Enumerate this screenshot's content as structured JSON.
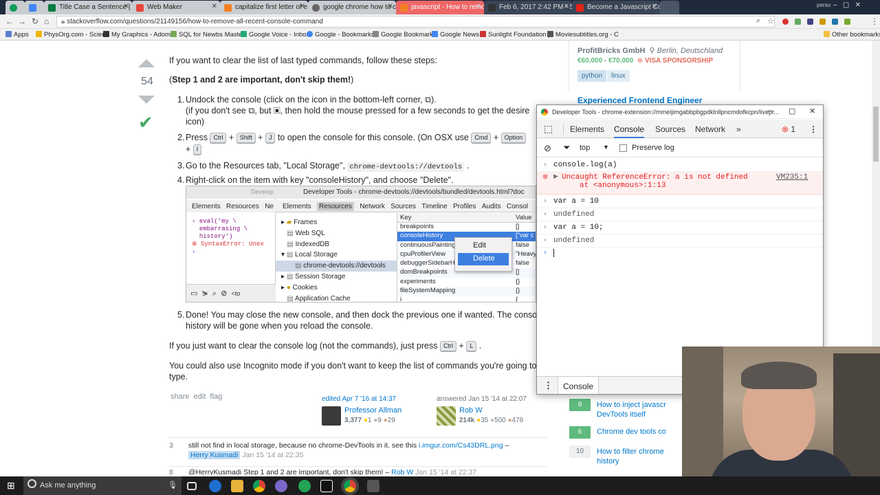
{
  "tabs": [
    {
      "label": "",
      "color": "#0f9d58"
    },
    {
      "label": "",
      "color": "#4285f4"
    },
    {
      "label": "Title Case a Sentence | Fr",
      "color": "#0a7b3e"
    },
    {
      "label": "Web Maker",
      "color": "#e8453c"
    },
    {
      "label": "capitalize first letter of e",
      "color": "#f48024"
    },
    {
      "label": "google chrome how to c",
      "color": "#666"
    },
    {
      "label": "javascript - How to remo",
      "color": "#f48024"
    },
    {
      "label": "Feb 6, 2017 2:42 PM - Sc",
      "color": "#333"
    },
    {
      "label": "Become a Javascript Con",
      "color": "#e62117"
    }
  ],
  "profile": "perso",
  "address": "stackoverflow.com/questions/21149156/how-to-remove-all-recent-console-command",
  "bookmarks": [
    "Apps",
    "PhysOrg.com - Scien",
    "My Graphics - Adom",
    "SQL for Newbs Maste",
    "Google Voice - Inbox",
    "Google - Bookmarks",
    "Google Bookmark",
    "Google News",
    "Sunlight Foundation |",
    "Moviesubtitles.org - С"
  ],
  "other_bookmarks": "Other bookmarks",
  "answer": {
    "vote_count": "54",
    "intro": "If you want to clear the list of last typed commands, follow these steps:",
    "bold_note": "Step 1 and 2 are important, don't skip them!",
    "step1_a": "Undock the console (click on the icon in the bottom-left corner,",
    "step1_b": "(if you don't see",
    "step1_c": ", but",
    "step1_d": ", then hold the mouse pressed for a few seconds to get the desire",
    "step1_e": "icon)",
    "step2_a": "Press",
    "step2_b": "to open the console for this console. (On OSX use",
    "key_ctrl": "Ctrl",
    "key_shift": "Shift",
    "key_j": "J",
    "key_cmd": "Cmd",
    "key_option": "Option",
    "key_i": "I",
    "key_l": "L",
    "step3": "Go to the Resources tab, \"Local Storage\",",
    "step3_code": "chrome-devtools://devtools",
    "step4": "Right-click on the item with key \"consoleHistory\", and choose \"Delete\".",
    "step5_a": "Done! You may close the new console, and then dock the previous one if wanted. The consol",
    "step5_b": "history will be gone when you reload the console.",
    "clear_log": "If you just want to clear the console log (not the commands), just press",
    "incognito_a": "You could also use Incognito mode if you don't want to keep the list of commands you're going to",
    "incognito_b": "type.",
    "actions": [
      "share",
      "edit",
      "flag"
    ],
    "edited": "edited Apr 7 '16 at 14:37",
    "editor": "Professor Allman",
    "editor_rep": "3,377",
    "editor_badges": [
      "1",
      "9",
      "29"
    ],
    "answered": "answered Jan 15 '14 at 22:07",
    "author": "Rob W",
    "author_rep": "214k",
    "author_badges": [
      "35",
      "500",
      "478"
    ]
  },
  "comments": [
    {
      "score": "3",
      "text": "still not find in local storage, because no chrome-DevTools in it. see this",
      "link": "i.imgur.com/Cs43DRL.png",
      "user": "Herry Kusmadi",
      "time": "Jan 15 '14 at 22:35"
    },
    {
      "score": "8",
      "text": "@HerryKusmadi Step 1 and 2 are important, don't skip them!",
      "link": "",
      "user": "Rob W",
      "time": "Jan 15 '14 at 22:37"
    }
  ],
  "embedded": {
    "left_tabs": [
      "Elements",
      "Resources",
      "Ne"
    ],
    "left_title": "Develop",
    "left_code": [
      "eval('my \\",
      "embarrasing \\",
      "history')",
      "SyntaxError: Unex"
    ],
    "title": "Developer Tools - chrome-devtools://devtools/bundled/devtools.html?doc",
    "tabs": [
      "Elements",
      "Resources",
      "Network",
      "Sources",
      "Timeline",
      "Profiles",
      "Audits",
      "Consol"
    ],
    "tree": [
      "Frames",
      "Web SQL",
      "IndexedDB",
      "Local Storage",
      "chrome-devtools://devtools",
      "Session Storage",
      "Cookies",
      "Application Cache"
    ],
    "col_key": "Key",
    "col_value": "Value",
    "keys": [
      "breakpoints",
      "consoleHistory",
      "continuousPainting",
      "cpuProfilerView",
      "debuggerSidebarHid",
      "domBreakpoints",
      "experiments",
      "fileSystemMapping",
      "i"
    ],
    "values": [
      "[]",
      "[\"var c",
      "false",
      "\"Heavy",
      "false",
      "[]",
      "{}",
      "{}",
      "{"
    ],
    "menu": [
      "Edit",
      "Delete"
    ]
  },
  "sidebar": {
    "company": "ProfitBricks GmbH",
    "location": "Berlin, Deutschland",
    "salary": "€60,000 - €70,000",
    "visa": "VISA SPONSORSHIP",
    "tags": [
      "python",
      "linux"
    ],
    "job2": "Experienced Frontend Engineer",
    "related": [
      {
        "count": "9",
        "text": "How to inject javascr",
        "text2": "DevTools itself",
        "answered": true
      },
      {
        "count": "6",
        "text": "Chrome dev tools co",
        "text2": "",
        "answered": true
      },
      {
        "count": "10",
        "text": "How to filter chrome",
        "text2": "history",
        "answered": false
      }
    ]
  },
  "devtools": {
    "title": "Developer Tools - chrome-extension://mmeijimgabbpbgpdklnllpncmdofkcpn/livepr...",
    "tabs": [
      "Elements",
      "Console",
      "Sources",
      "Network"
    ],
    "error_count": "1",
    "context": "top",
    "preserve_log": "Preserve log",
    "lines": [
      {
        "kind": "input",
        "text": "console.log(a)"
      },
      {
        "kind": "error",
        "text": "Uncaught ReferenceError: a is not defined",
        "text2": "at <anonymous>:1:13",
        "source": "VM235:1"
      },
      {
        "kind": "input",
        "text": "var a = 10"
      },
      {
        "kind": "output",
        "text": "undefined"
      },
      {
        "kind": "input",
        "text": "var a = 10;"
      },
      {
        "kind": "output",
        "text": "undefined"
      }
    ],
    "drawer_tab": "Console"
  },
  "taskbar": {
    "search": "Ask me anything"
  }
}
